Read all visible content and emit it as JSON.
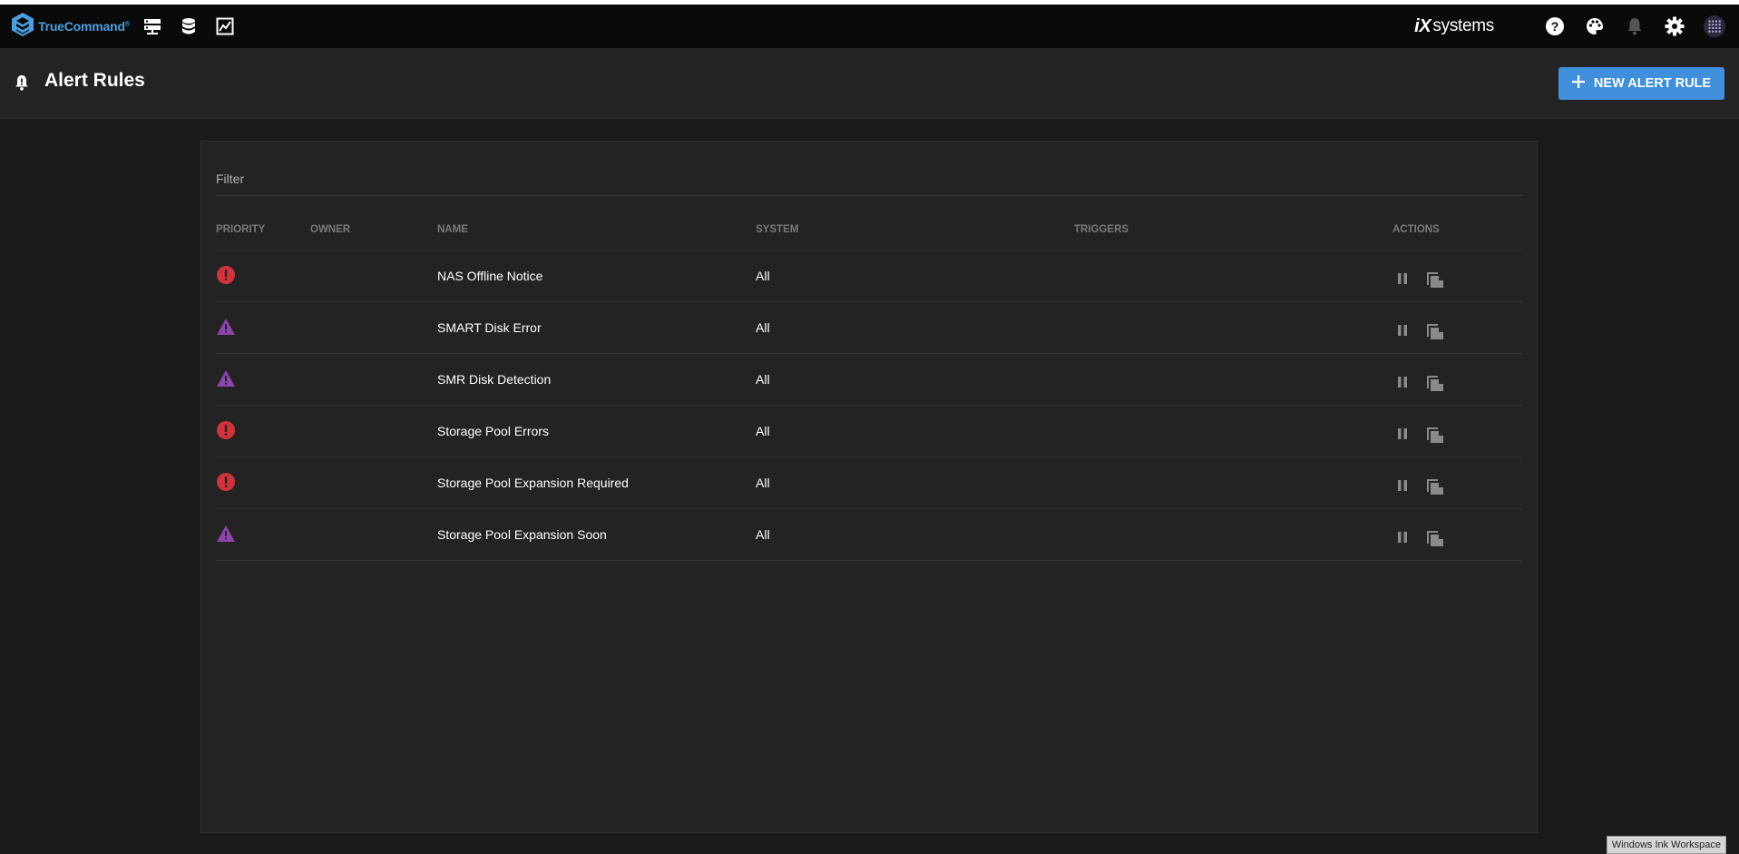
{
  "app": {
    "name": "TrueCommand",
    "trademark": "®"
  },
  "brand": {
    "ix": "iX",
    "systems": "systems"
  },
  "page": {
    "title": "Alert Rules"
  },
  "actions": {
    "new_alert_rule": "NEW ALERT RULE"
  },
  "filter": {
    "label": "Filter"
  },
  "table": {
    "headers": {
      "priority": "PRIORITY",
      "owner": "OWNER",
      "name": "NAME",
      "system": "SYSTEM",
      "triggers": "TRIGGERS",
      "actions": "ACTIONS"
    },
    "rows": [
      {
        "priority": "critical",
        "owner": "",
        "name": "NAS Offline Notice",
        "system": "All",
        "triggers": ""
      },
      {
        "priority": "warning",
        "owner": "",
        "name": "SMART Disk Error",
        "system": "All",
        "triggers": ""
      },
      {
        "priority": "warning",
        "owner": "",
        "name": "SMR Disk Detection",
        "system": "All",
        "triggers": ""
      },
      {
        "priority": "critical",
        "owner": "",
        "name": "Storage Pool Errors",
        "system": "All",
        "triggers": ""
      },
      {
        "priority": "critical",
        "owner": "",
        "name": "Storage Pool Expansion Required",
        "system": "All",
        "triggers": ""
      },
      {
        "priority": "warning",
        "owner": "",
        "name": "Storage Pool Expansion Soon",
        "system": "All",
        "triggers": ""
      }
    ]
  },
  "colors": {
    "accent": "#3f8fdc",
    "critical": "#d0343a",
    "warning": "#8e44ad",
    "logo": "#4a9fe0"
  },
  "taskbar": {
    "ink_workspace": "Windows Ink Workspace"
  }
}
